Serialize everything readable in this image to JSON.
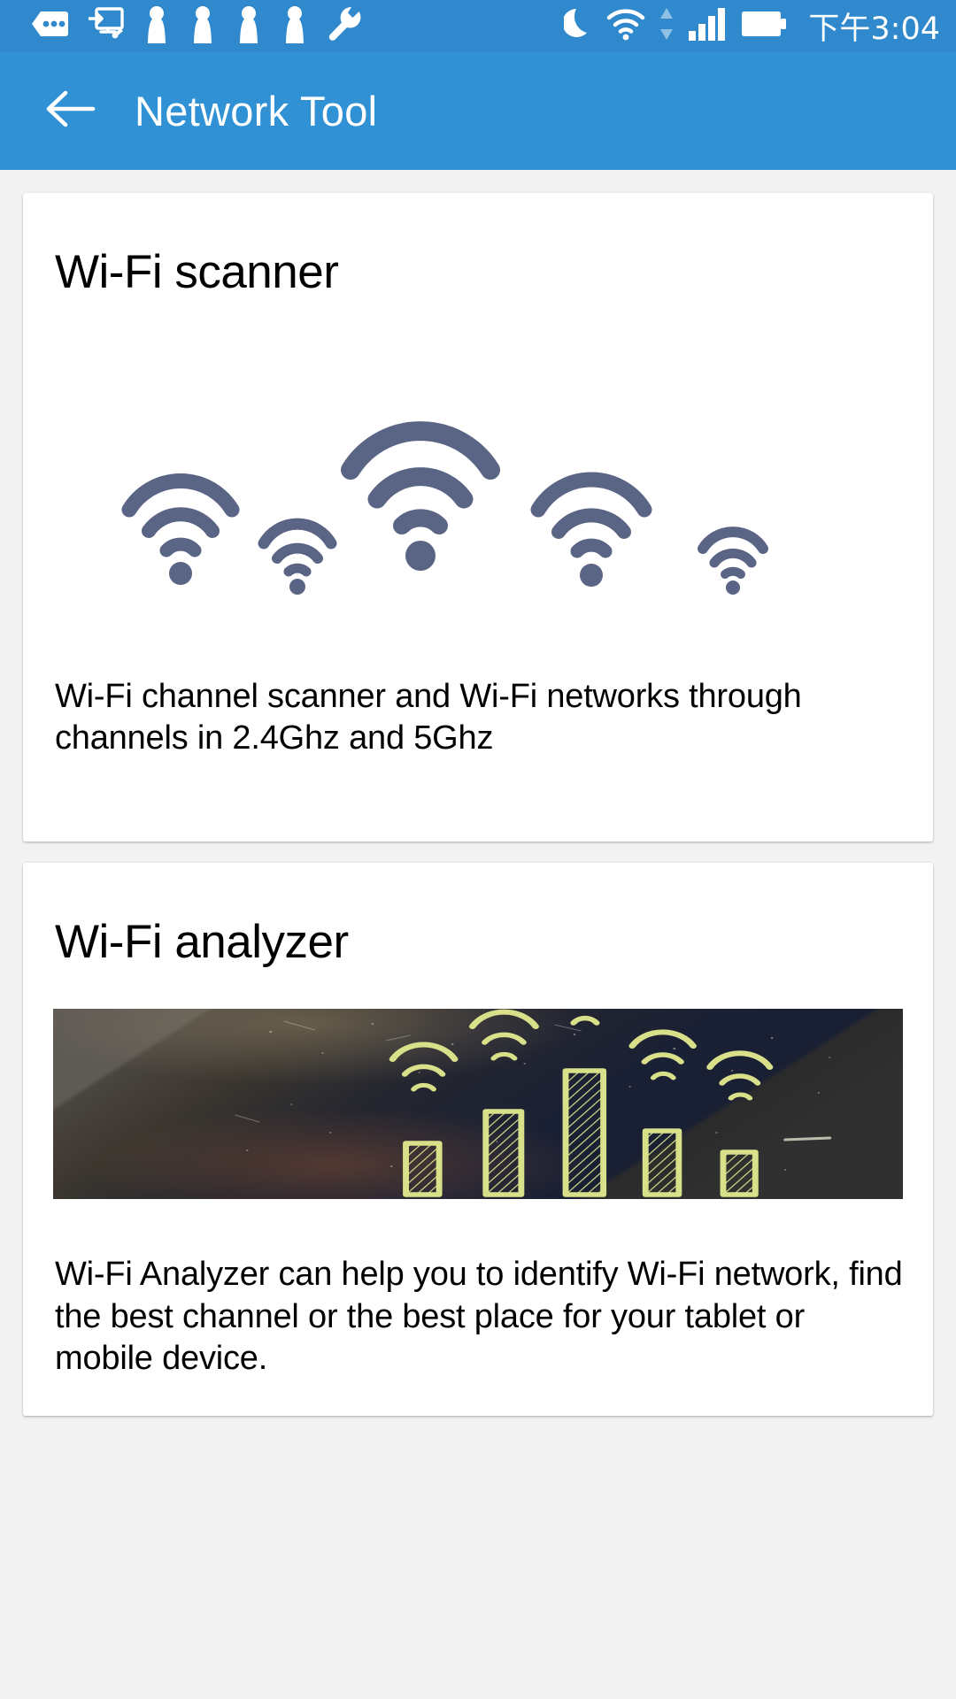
{
  "status_bar": {
    "time": "下午3:04",
    "background_color": "#2f89cc",
    "icons": [
      {
        "name": "message-dots-icon",
        "label": "messages"
      },
      {
        "name": "screen-cast-icon",
        "label": "screen cast"
      },
      {
        "name": "pawn-icon-1",
        "label": "pawn"
      },
      {
        "name": "pawn-icon-2",
        "label": "pawn"
      },
      {
        "name": "pawn-icon-3",
        "label": "pawn"
      },
      {
        "name": "pawn-icon-4",
        "label": "pawn"
      },
      {
        "name": "wrench-icon",
        "label": "settings"
      },
      {
        "name": "moon-icon",
        "label": "do not disturb"
      },
      {
        "name": "wifi-icon",
        "label": "wifi signal"
      },
      {
        "name": "data-transfer-arrows-icon",
        "label": "data transfer"
      },
      {
        "name": "cellular-signal-icon",
        "label": "cellular signal"
      },
      {
        "name": "battery-icon",
        "label": "battery"
      }
    ]
  },
  "app_bar": {
    "title": "Network Tool",
    "back_icon": "arrow-left-icon",
    "background_color": "#3091d4",
    "text_color": "#ffffff"
  },
  "cards": [
    {
      "id": "wifi-scanner",
      "title": "Wi-Fi scanner",
      "description": "Wi-Fi channel scanner and Wi-Fi networks through channels in 2.4Ghz and 5Ghz",
      "illustration": "wifi-arcs-illustration",
      "illustration_color": "#5a6485"
    },
    {
      "id": "wifi-analyzer",
      "title": "Wi-Fi analyzer",
      "description": "Wi-Fi Analyzer can help you to identify Wi-Fi network, find the best channel or the best place for your tablet or mobile device.",
      "illustration": "chalkboard-signal-bars-photo",
      "illustration_color": "#d8e08a"
    }
  ]
}
